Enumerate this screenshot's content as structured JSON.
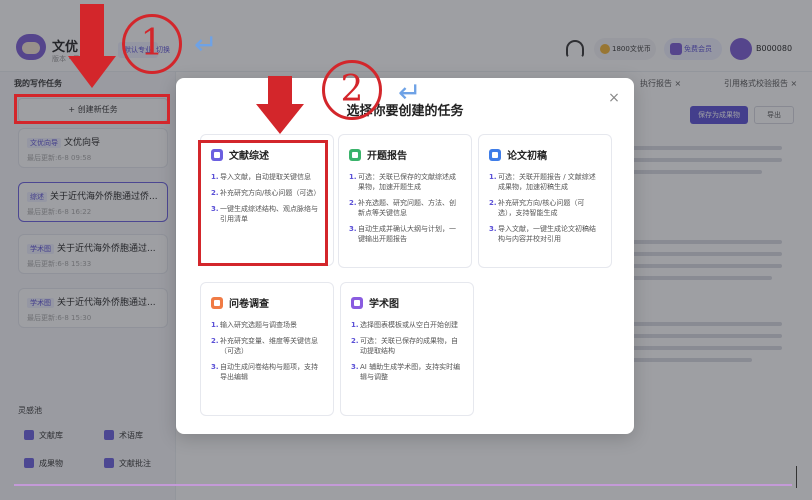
{
  "header": {
    "app_title": "文优",
    "app_sub": "版本 · 尽 作",
    "mode_badge": "默认专业",
    "mode_switch": "切换",
    "coins": "1800文优币",
    "member": "免费会员",
    "user": "B000080"
  },
  "sidebar": {
    "heading": "我的写作任务",
    "create_button": "+ 创建新任务",
    "tasks": [
      {
        "tag": "文优向导",
        "title": "文优向导",
        "time": "最后更新:6-8 09:58"
      },
      {
        "tag": "综述",
        "title": "关于近代海外侨胞通过侨...",
        "time": "最后更新:6-8 16:22"
      },
      {
        "tag": "学术图",
        "title": "关于近代海外侨胞通过...",
        "time": "最后更新:6-8 15:33"
      },
      {
        "tag": "学术图",
        "title": "关于近代海外侨胞通过...",
        "time": "最后更新:6-8 15:30"
      }
    ],
    "lingxi": "灵感池",
    "tools": [
      "文献库",
      "术语库",
      "成果物",
      "文献批注"
    ]
  },
  "main": {
    "tabs": [
      "执行报告 ×",
      "引用格式校验报告 ×"
    ],
    "save_button": "保存为成果物",
    "export_button": "导出"
  },
  "modal": {
    "title": "选择你要创建的任务",
    "close": "×",
    "cards": [
      {
        "title": "文献综述",
        "icon": "literature-review-icon",
        "color": "#6b5fe0",
        "steps": [
          "导入文献，自动提取关键信息",
          "补充研究方向/核心问题（可选）",
          "一键生成综述结构、观点脉络与引用清单"
        ]
      },
      {
        "title": "开题报告",
        "icon": "proposal-icon",
        "color": "#3ab36b",
        "steps": [
          "可选：关联已保存的文献综述成果物，加速开题生成",
          "补充选题、研究问题、方法、创新点等关键信息",
          "自动生成并确认大纲与计划，一键输出开题报告"
        ]
      },
      {
        "title": "论文初稿",
        "icon": "draft-icon",
        "color": "#3f7de8",
        "steps": [
          "可选：关联开题报告 / 文献综述成果物，加速初稿生成",
          "补充研究方向/核心问题（可选），支持智能生成",
          "导入文献，一键生成论文初稿结构与内容并校对引用"
        ]
      },
      {
        "title": "问卷调查",
        "icon": "survey-icon",
        "color": "#f07b45",
        "steps": [
          "输入研究选题与调查场景",
          "补充研究变量、维度等关键信息（可选）",
          "自动生成问卷结构与题项，支持导出编辑"
        ]
      },
      {
        "title": "学术图",
        "icon": "academic-chart-icon",
        "color": "#8a5ce0",
        "steps": [
          "选择图表模板或从空白开始创建",
          "可选：关联已保存的成果物，自动提取结构",
          "AI 辅助生成学术图，支持实时编辑与调整"
        ]
      }
    ]
  },
  "annotations": {
    "step_one": "1",
    "step_two": "2",
    "return_symbol": "↵",
    "accent": "#d3262b"
  }
}
